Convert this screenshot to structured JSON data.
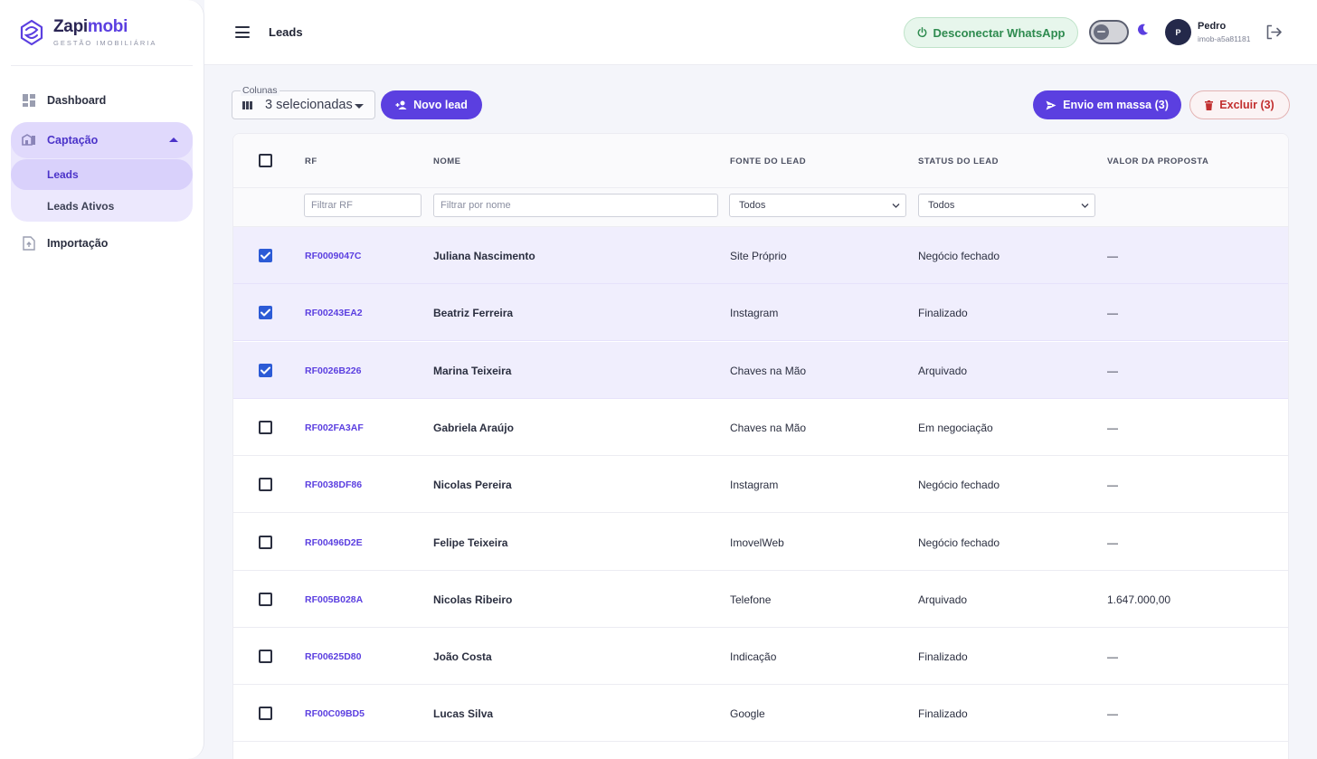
{
  "brand": {
    "name_part1": "Zapi",
    "name_part2": "mobi",
    "subtitle": "GESTÃO IMOBILIÁRIA"
  },
  "sidebar": {
    "dashboard": "Dashboard",
    "group": {
      "label": "Captação",
      "items": [
        {
          "label": "Leads"
        },
        {
          "label": "Leads Ativos"
        }
      ]
    },
    "importacao": "Importação"
  },
  "header": {
    "title": "Leads",
    "whatsapp_button": "Desconectar WhatsApp",
    "user": {
      "initial": "P",
      "name": "Pedro",
      "id": "imob-a5a81181"
    }
  },
  "toolbar": {
    "columns_label": "Colunas",
    "columns_value": "3 selecionadas",
    "new_lead": "Novo lead",
    "bulk_send": "Envio em massa (3)",
    "delete": "Excluir (3)"
  },
  "table": {
    "headers": {
      "rf": "RF",
      "nome": "NOME",
      "fonte": "FONTE DO LEAD",
      "status": "STATUS DO LEAD",
      "valor": "VALOR DA PROPOSTA"
    },
    "filters": {
      "rf_placeholder": "Filtrar RF",
      "nome_placeholder": "Filtrar por nome",
      "fonte": "Todos",
      "status": "Todos"
    },
    "rows": [
      {
        "selected": true,
        "rf": "RF0009047C",
        "nome": "Juliana Nascimento",
        "fonte": "Site Próprio",
        "status": "Negócio fechado",
        "valor": "—"
      },
      {
        "selected": true,
        "rf": "RF00243EA2",
        "nome": "Beatriz Ferreira",
        "fonte": "Instagram",
        "status": "Finalizado",
        "valor": "—"
      },
      {
        "selected": true,
        "rf": "RF0026B226",
        "nome": "Marina Teixeira",
        "fonte": "Chaves na Mão",
        "status": "Arquivado",
        "valor": "—"
      },
      {
        "selected": false,
        "rf": "RF002FA3AF",
        "nome": "Gabriela Araújo",
        "fonte": "Chaves na Mão",
        "status": "Em negociação",
        "valor": "—"
      },
      {
        "selected": false,
        "rf": "RF0038DF86",
        "nome": "Nicolas Pereira",
        "fonte": "Instagram",
        "status": "Negócio fechado",
        "valor": "—"
      },
      {
        "selected": false,
        "rf": "RF00496D2E",
        "nome": "Felipe Teixeira",
        "fonte": "ImovelWeb",
        "status": "Negócio fechado",
        "valor": "—"
      },
      {
        "selected": false,
        "rf": "RF005B028A",
        "nome": "Nicolas Ribeiro",
        "fonte": "Telefone",
        "status": "Arquivado",
        "valor": "1.647.000,00"
      },
      {
        "selected": false,
        "rf": "RF00625D80",
        "nome": "João Costa",
        "fonte": "Indicação",
        "status": "Finalizado",
        "valor": "—"
      },
      {
        "selected": false,
        "rf": "RF00C09BD5",
        "nome": "Lucas Silva",
        "fonte": "Google",
        "status": "Finalizado",
        "valor": "—"
      }
    ]
  },
  "colors": {
    "accent": "#5b3fe0",
    "checkbox": "#2c5bd6",
    "danger": "#c22f2f",
    "success": "#2e8b4f"
  }
}
